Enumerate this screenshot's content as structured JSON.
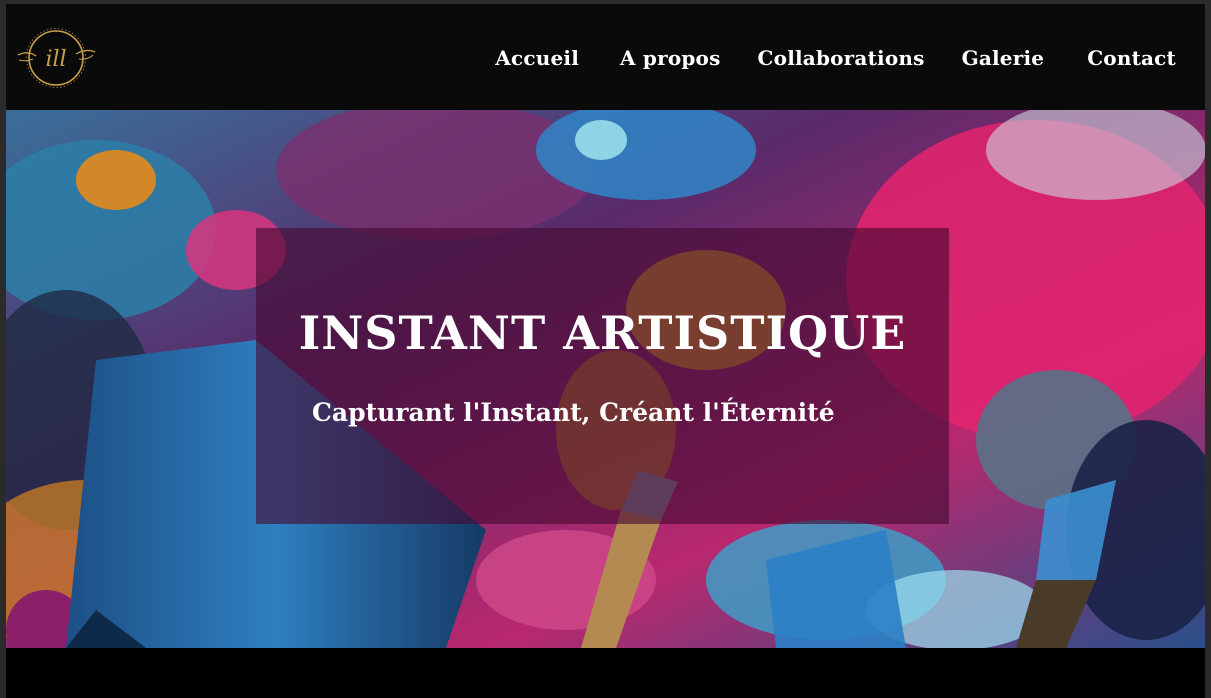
{
  "header": {
    "logo": {
      "monogram": "ill",
      "icon": "gold-circle-monogram-logo"
    },
    "nav": [
      {
        "label": "Accueil"
      },
      {
        "label": "A propos"
      },
      {
        "label": "Collaborations"
      },
      {
        "label": "Galerie"
      },
      {
        "label": "Contact"
      }
    ]
  },
  "hero": {
    "title": "INSTANT ARTISTIQUE",
    "subtitle": "Capturant l'Instant, Créant l'Éternité",
    "background": "abstract-paint-brushes-image",
    "overlay_color": "#460a32"
  },
  "colors": {
    "navbar": "#0a0a0a",
    "nav_text": "#ffffff",
    "logo_gold": "#c9a04a"
  }
}
